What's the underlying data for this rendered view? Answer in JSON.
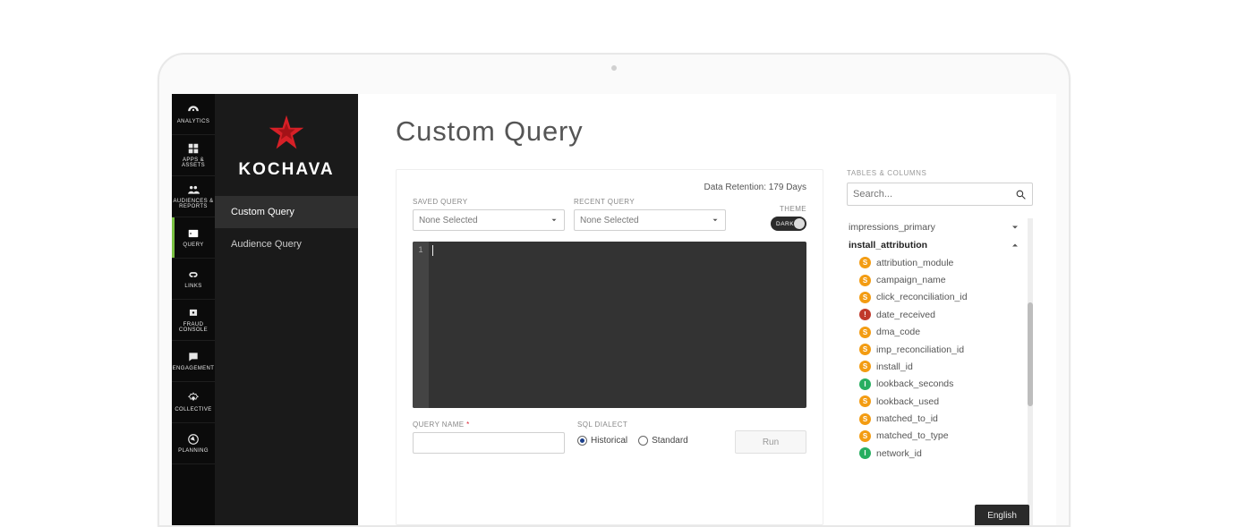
{
  "brand": {
    "name": "KOCHAVA"
  },
  "nav": {
    "items": [
      {
        "label": "ANALYTICS"
      },
      {
        "label": "APPS & ASSETS"
      },
      {
        "label": "AUDIENCES & REPORTS"
      },
      {
        "label": "QUERY"
      },
      {
        "label": "LINKS"
      },
      {
        "label": "FRAUD CONSOLE"
      },
      {
        "label": "ENGAGEMENT"
      },
      {
        "label": "COLLECTIVE"
      },
      {
        "label": "PLANNING"
      }
    ]
  },
  "submenu": {
    "items": [
      {
        "label": "Custom Query"
      },
      {
        "label": "Audience Query"
      }
    ]
  },
  "page": {
    "title": "Custom Query"
  },
  "retention": {
    "text": "Data Retention: 179 Days"
  },
  "controls": {
    "saved_label": "SAVED QUERY",
    "saved_value": "None Selected",
    "recent_label": "RECENT QUERY",
    "recent_value": "None Selected",
    "theme_label": "THEME",
    "theme_value": "DARK",
    "name_label": "QUERY NAME",
    "dialect_label": "SQL DIALECT",
    "dialect_options": {
      "historical": "Historical",
      "standard": "Standard"
    },
    "run_label": "Run"
  },
  "editor": {
    "line1": "1"
  },
  "tables": {
    "title": "TABLES & COLUMNS",
    "search_placeholder": "Search...",
    "collapsed_table": "impressions_primary",
    "expanded_table": "install_attribution",
    "columns": [
      {
        "type": "s",
        "name": "attribution_module"
      },
      {
        "type": "s",
        "name": "campaign_name"
      },
      {
        "type": "s",
        "name": "click_reconciliation_id"
      },
      {
        "type": "t",
        "name": "date_received"
      },
      {
        "type": "s",
        "name": "dma_code"
      },
      {
        "type": "s",
        "name": "imp_reconciliation_id"
      },
      {
        "type": "s",
        "name": "install_id"
      },
      {
        "type": "i",
        "name": "lookback_seconds"
      },
      {
        "type": "s",
        "name": "lookback_used"
      },
      {
        "type": "s",
        "name": "matched_to_id"
      },
      {
        "type": "s",
        "name": "matched_to_type"
      },
      {
        "type": "i",
        "name": "network_id"
      }
    ]
  },
  "lang": {
    "label": "English"
  }
}
